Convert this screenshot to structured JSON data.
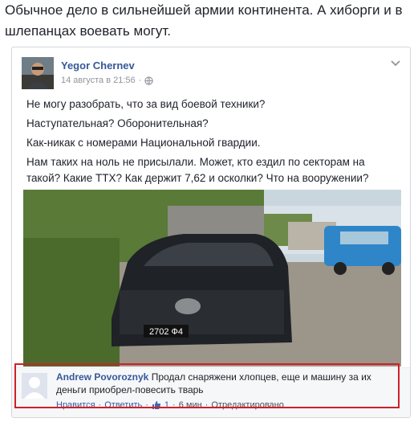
{
  "headline": "Обычное дело в сильнейшей армии континента. А хиборги и в шлепанцах воевать могут.",
  "post": {
    "author": "Yegor Chernev",
    "timestamp": "14 августа в 21:56",
    "separator": "·",
    "privacy_icon": "globe-icon",
    "menu_icon": "chevron-down-icon",
    "paragraphs": [
      "Не могу разобрать, что за вид боевой техники?",
      "Наступательная? Оборонительная?",
      "Как-никак с номерами Национальной гвардии.",
      "Нам таких на ноль не присылали. Может, кто ездил по секторам на такой? Какие ТТХ? Как держит 7,62 и осколки? Что на вооружении?"
    ],
    "photo": {
      "plate": "2702 Ф4",
      "description_colors": {
        "car": "#1f2226",
        "sky": "#c9d6de",
        "trees": "#4b6b2c",
        "ground": "#9c958a",
        "old_car": "#2e86c9"
      }
    }
  },
  "comment": {
    "author": "Andrew Povoroznyk",
    "text": "Продал снаряжени хлопцев, еще и машину за их деньги приобрел-повесить тварь",
    "like_label": "Нравится",
    "reply_label": "Ответить",
    "like_count": "1",
    "time": "6 мин",
    "edited": "Отредактировано",
    "separator": "·"
  },
  "colors": {
    "link": "#365899",
    "highlight": "#d0202a",
    "muted": "#90949c"
  }
}
